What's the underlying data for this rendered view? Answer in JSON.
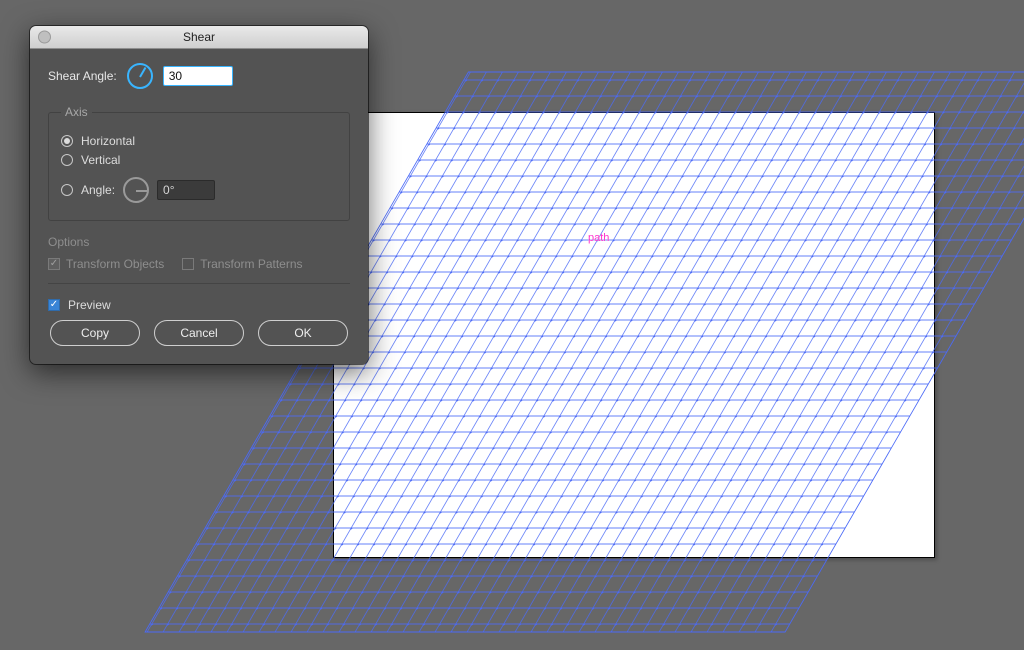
{
  "dialog": {
    "title": "Shear",
    "shear_angle_label": "Shear Angle:",
    "shear_angle_value": "30",
    "shear_angle_deg": -60,
    "axis": {
      "legend": "Axis",
      "horizontal_label": "Horizontal",
      "vertical_label": "Vertical",
      "angle_option_label": "Angle:",
      "angle_value": "0°",
      "angle_dial_deg": 0,
      "selected": "horizontal"
    },
    "options": {
      "title": "Options",
      "transform_objects_label": "Transform Objects",
      "transform_objects_checked": true,
      "transform_patterns_label": "Transform Patterns",
      "transform_patterns_checked": false,
      "disabled": true
    },
    "preview_label": "Preview",
    "preview_checked": true,
    "buttons": {
      "copy": "Copy",
      "cancel": "Cancel",
      "ok": "OK"
    }
  },
  "canvas": {
    "path_hint": "path",
    "grid": {
      "cell": 16,
      "line_color": "#4b6af7",
      "node_color": "#4b6af7",
      "shear_deg": 30
    }
  },
  "colors": {
    "accent": "#39b5ff"
  }
}
